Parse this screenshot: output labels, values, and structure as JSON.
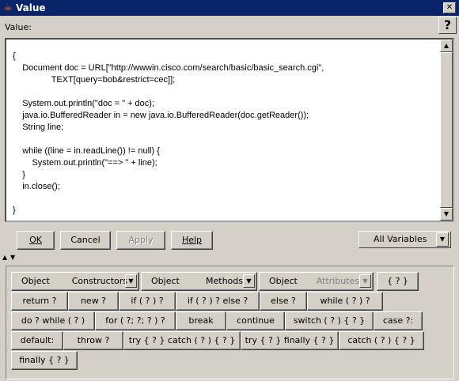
{
  "window": {
    "title": "Value",
    "icon": "java-cup-icon",
    "close_glyph": "✕"
  },
  "field_label": "Value:",
  "help_glyph": "?",
  "editor": {
    "code": "{\n    Document doc = URL[\"http://wwwin.cisco.com/search/basic/basic_search.cgi\",\n                TEXT[query=bob&restrict=cec]];\n\n    System.out.println(\"doc = \" + doc);\n    java.io.BufferedReader in = new java.io.BufferedReader(doc.getReader());\n    String line;\n\n    while ((line = in.readLine()) != null) {\n        System.out.println(\"==> \" + line);\n    }\n    in.close();\n\n}"
  },
  "buttons": {
    "ok": "OK",
    "cancel": "Cancel",
    "apply": "Apply",
    "help": "Help"
  },
  "variables_dropdown": {
    "selected": "All Variables"
  },
  "palette": {
    "row1": {
      "constructors": {
        "object": "Object",
        "selected": "Constructors"
      },
      "methods": {
        "object": "Object",
        "selected": "Methods"
      },
      "attributes": {
        "object": "Object",
        "selected": "Attributes"
      },
      "block": "{ ? }"
    },
    "row2": [
      "return ?",
      "new ?",
      "if ( ? ) ?",
      "if ( ? ) ? else ?",
      "else ?",
      "while ( ? ) ?"
    ],
    "row3": [
      "do ? while ( ? )",
      "for ( ?; ?; ? ) ?",
      "break",
      "continue",
      "switch ( ? ) { ? }",
      "case ?:"
    ],
    "row4": [
      "default:",
      "throw ?",
      "try { ? } catch ( ? ) { ? }",
      "try { ? } finally { ? }",
      "catch ( ? ) { ? }"
    ],
    "row5": [
      "finally { ? }"
    ]
  }
}
